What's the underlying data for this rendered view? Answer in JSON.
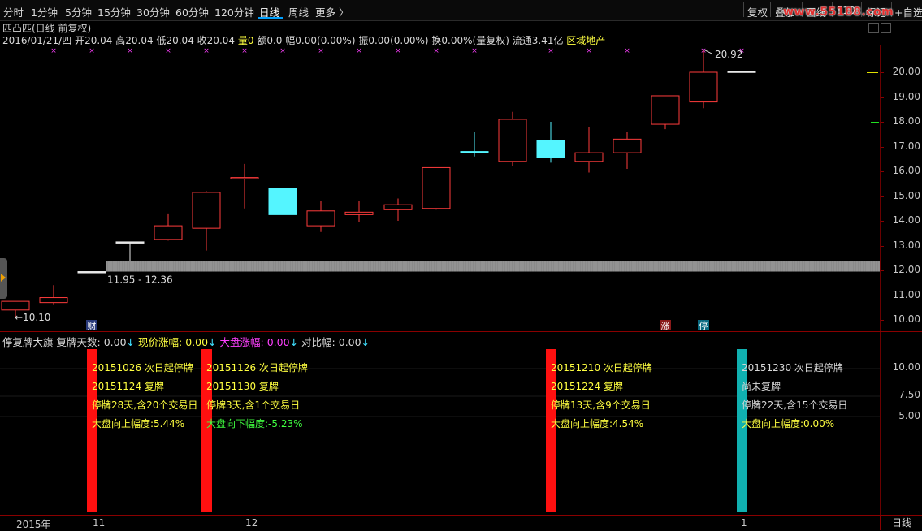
{
  "toolbar": {
    "timeframes": [
      "分时",
      "1分钟",
      "5分钟",
      "15分钟",
      "30分钟",
      "60分钟",
      "120分钟",
      "日线",
      "周线",
      "更多 〉"
    ],
    "active_timeframe": "日线",
    "right_buttons": [
      "复权",
      "叠加",
      "画线",
      "F10",
      "标记",
      "+自选"
    ],
    "watermark": "www.55188.com"
  },
  "stock": {
    "title": "匹凸匹(日线 前复权)",
    "date": "2016/01/21/四",
    "open_label": "开",
    "open": "20.04",
    "high_label": "高",
    "high": "20.04",
    "low_label": "低",
    "low": "20.04",
    "close_label": "收",
    "close": "20.04",
    "volume_label": "量",
    "volume": "0",
    "amount_label": "额",
    "amount": "0.0",
    "change_label": "幅",
    "change": "0.00(0.00%)",
    "amplitude_label": "振",
    "amplitude": "0.00(0.00%)",
    "turnover_label": "换",
    "turnover": "0.00%",
    "adjust_note": "(量复权)",
    "float_label": "流通",
    "float_cap": "3.41亿",
    "sector": "区域地产"
  },
  "main_axis": {
    "ticks": [
      "20.00",
      "19.00",
      "18.00",
      "17.00",
      "16.00",
      "15.00",
      "14.00",
      "13.00",
      "12.00",
      "11.00",
      "10.00"
    ]
  },
  "chart_annotations": {
    "high_price": "20.92",
    "low_price": "10.10",
    "gap_range": "11.95 - 12.36",
    "markers": [
      "财",
      "涨",
      "停"
    ]
  },
  "chart_data": {
    "type": "candlestick",
    "y_range": [
      9.8,
      21.0
    ],
    "candles": [
      {
        "o": 10.4,
        "c": 10.75,
        "h": 10.75,
        "l": 10.1,
        "up": true
      },
      {
        "o": 10.7,
        "c": 10.9,
        "h": 11.4,
        "l": 10.6,
        "up": true
      },
      {
        "o": 11.95,
        "c": 11.95,
        "h": 11.95,
        "l": 11.95,
        "up": true
      },
      {
        "o": 13.15,
        "c": 13.15,
        "h": 13.15,
        "l": 12.36,
        "up": true
      },
      {
        "o": 13.25,
        "c": 13.8,
        "h": 14.3,
        "l": 13.2,
        "up": true
      },
      {
        "o": 13.7,
        "c": 15.15,
        "h": 15.2,
        "l": 12.8,
        "up": true
      },
      {
        "o": 15.75,
        "c": 15.75,
        "h": 16.3,
        "l": 14.5,
        "up": true
      },
      {
        "o": 15.3,
        "c": 14.25,
        "h": 15.3,
        "l": 14.25,
        "up": false
      },
      {
        "o": 13.8,
        "c": 14.4,
        "h": 14.8,
        "l": 13.55,
        "up": true
      },
      {
        "o": 14.25,
        "c": 14.35,
        "h": 14.8,
        "l": 13.95,
        "up": true
      },
      {
        "o": 14.45,
        "c": 14.65,
        "h": 14.9,
        "l": 14.0,
        "up": true
      },
      {
        "o": 14.5,
        "c": 16.15,
        "h": 16.15,
        "l": 14.45,
        "up": true
      },
      {
        "o": 16.8,
        "c": 16.8,
        "h": 17.6,
        "l": 16.6,
        "up": false
      },
      {
        "o": 16.4,
        "c": 18.1,
        "h": 18.4,
        "l": 16.2,
        "up": true
      },
      {
        "o": 17.25,
        "c": 16.55,
        "h": 18.0,
        "l": 16.35,
        "up": false
      },
      {
        "o": 16.4,
        "c": 16.75,
        "h": 17.8,
        "l": 15.95,
        "up": true
      },
      {
        "o": 16.75,
        "c": 17.3,
        "h": 17.6,
        "l": 16.1,
        "up": true
      },
      {
        "o": 17.9,
        "c": 19.05,
        "h": 19.05,
        "l": 17.7,
        "up": true
      },
      {
        "o": 18.8,
        "c": 20.0,
        "h": 20.92,
        "l": 18.55,
        "up": true
      },
      {
        "o": 20.04,
        "c": 20.04,
        "h": 20.04,
        "l": 20.04,
        "up": true
      }
    ],
    "gap_band": [
      11.95,
      12.36
    ]
  },
  "indicator": {
    "name": "停复牌大旗",
    "days_label": "复牌天数:",
    "days_value": "0.00",
    "cur_label": "现价涨幅:",
    "cur_value": "0.00",
    "market_label": "大盘涨幅:",
    "market_value": "0.00",
    "compare_label": "对比幅:",
    "compare_value": "0.00",
    "sub_ticks": [
      "10.00",
      "7.50",
      "5.00"
    ],
    "events": [
      {
        "line1": "20151026 次日起停牌",
        "line2": "20151124 复牌",
        "line3": "停牌28天,含20个交易日",
        "line4": "大盘向上幅度:5.44%"
      },
      {
        "line1": "20151126 次日起停牌",
        "line2": "20151130 复牌",
        "line3": "停牌3天,含1个交易日",
        "line4": "大盘向下幅度:-5.23%"
      },
      {
        "line1": "20151210 次日起停牌",
        "line2": "20151224 复牌",
        "line3": "停牌13天,含9个交易日",
        "line4": "大盘向上幅度:4.54%"
      },
      {
        "line1": "20151230 次日起停牌",
        "line2": "尚未复牌",
        "line3": "停牌22天,含15个交易日",
        "line4": "大盘向上幅度:0.00%"
      }
    ]
  },
  "bottom_axis": {
    "labels": [
      "2015年",
      "11",
      "12",
      "1"
    ],
    "period": "日线"
  },
  "colors": {
    "up": "#ff3c3c",
    "down": "#54f5ff",
    "band": "#8a8a8a",
    "flag_red": "#ff1010",
    "flag_teal": "#10b0b0"
  }
}
